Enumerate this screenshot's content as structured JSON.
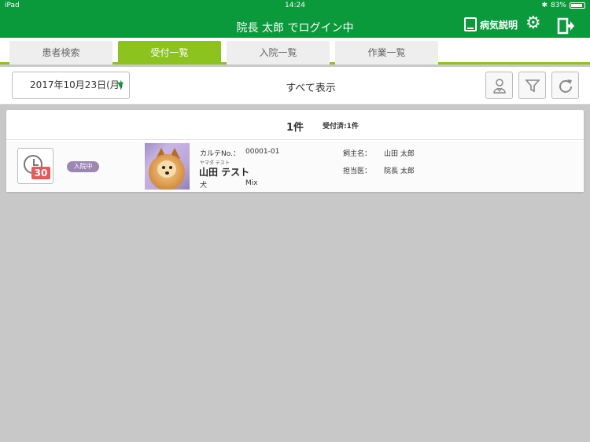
{
  "statusbar": {
    "device": "iPad",
    "time": "14:24",
    "battery": "83%"
  },
  "header": {
    "title": "院長 太郎 でログイン中",
    "disease_label": "病気説明"
  },
  "tabs": [
    {
      "label": "患者検索",
      "active": false
    },
    {
      "label": "受付一覧",
      "active": true
    },
    {
      "label": "入院一覧",
      "active": false
    },
    {
      "label": "作業一覧",
      "active": false
    }
  ],
  "toolbar": {
    "date": "2017年10月23日(月)",
    "filter_text": "すべて表示",
    "buttons": [
      "doctor-icon",
      "filter-icon",
      "refresh-icon"
    ]
  },
  "summary": {
    "count": "1件",
    "received": "受付済:1件"
  },
  "patient": {
    "clock_badge": "30",
    "status": "入院中",
    "chart_no_label": "カルテNo.：",
    "chart_no": "00001-01",
    "name_ruby": "ヤマダ テスト",
    "name": "山田 テスト",
    "species": "犬",
    "breed": "Mix",
    "owner_label": "飼主名：",
    "owner": "山田 太郎",
    "doctor_label": "担当医：",
    "doctor": "院長 太郎"
  },
  "colors": {
    "header_green": "#0a9a3c",
    "tab_active": "#8dc31e",
    "status_badge": "#9c86b2",
    "clock_badge": "#e55a5a"
  }
}
